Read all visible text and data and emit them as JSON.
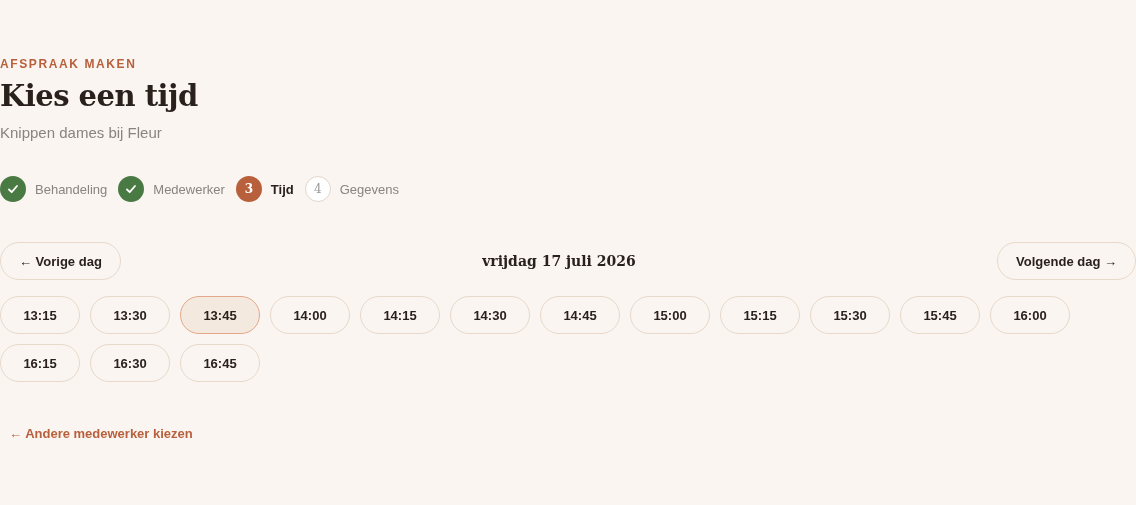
{
  "eyebrow": "AFSPRAAK MAKEN",
  "title": "Kies een tijd",
  "subtitle": "Knippen dames bij Fleur",
  "steps": [
    {
      "label": "Behandeling",
      "done": true,
      "current": false
    },
    {
      "label": "Medewerker",
      "done": true,
      "current": false
    },
    {
      "number": "3",
      "label": "Tijd",
      "done": false,
      "current": true
    },
    {
      "number": "4",
      "label": "Gegevens",
      "done": false,
      "current": false
    }
  ],
  "previous_day": "← Vorige dag",
  "date": "vrijdag 17 juli 2026",
  "next_day": "Volgende dag →",
  "slots": [
    {
      "time": "13:15",
      "selected": false
    },
    {
      "time": "13:30",
      "selected": false
    },
    {
      "time": "13:45",
      "selected": true
    },
    {
      "time": "14:00",
      "selected": false
    },
    {
      "time": "14:15",
      "selected": false
    },
    {
      "time": "14:30",
      "selected": false
    },
    {
      "time": "14:45",
      "selected": false
    },
    {
      "time": "15:00",
      "selected": false
    },
    {
      "time": "15:15",
      "selected": false
    },
    {
      "time": "15:30",
      "selected": false
    },
    {
      "time": "15:45",
      "selected": false
    },
    {
      "time": "16:00",
      "selected": false
    },
    {
      "time": "16:15",
      "selected": false
    },
    {
      "time": "16:30",
      "selected": false
    },
    {
      "time": "16:45",
      "selected": false
    }
  ],
  "back_link": "← Andere medewerker kiezen"
}
